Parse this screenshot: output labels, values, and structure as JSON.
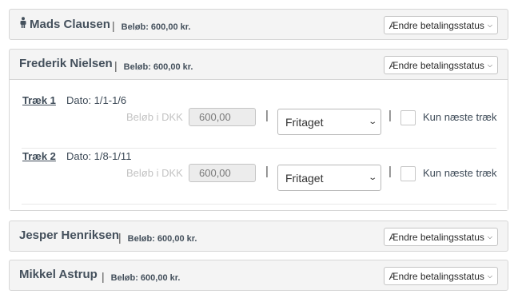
{
  "status_button_label": "Ændre betalingsstatus",
  "participants": [
    {
      "name": "Mads Clausen",
      "amount_text": "Beløb: 600,00 kr.",
      "icon": "person-icon"
    },
    {
      "name": "Frederik Nielsen",
      "amount_text": "Beløb: 600,00 kr."
    },
    {
      "name": "Jesper Henriksen",
      "amount_text": "Beløb: 600,00 kr."
    },
    {
      "name": "Mikkel Astrup",
      "amount_text": "Beløb: 600,00 kr."
    }
  ],
  "draws": [
    {
      "link": "Træk 1",
      "date": "Dato: 1/1-1/6",
      "amount_label": "Beløb i DKK",
      "amount_value": "600,00",
      "status": "Fritaget",
      "checkbox_label": "Kun næste træk",
      "checked": false
    },
    {
      "link": "Træk 2",
      "date": "Dato: 1/8-1/11",
      "amount_label": "Beløb i DKK",
      "amount_value": "600,00",
      "status": "Fritaget",
      "checkbox_label": "Kun næste træk",
      "checked": false
    }
  ],
  "separator": "|"
}
